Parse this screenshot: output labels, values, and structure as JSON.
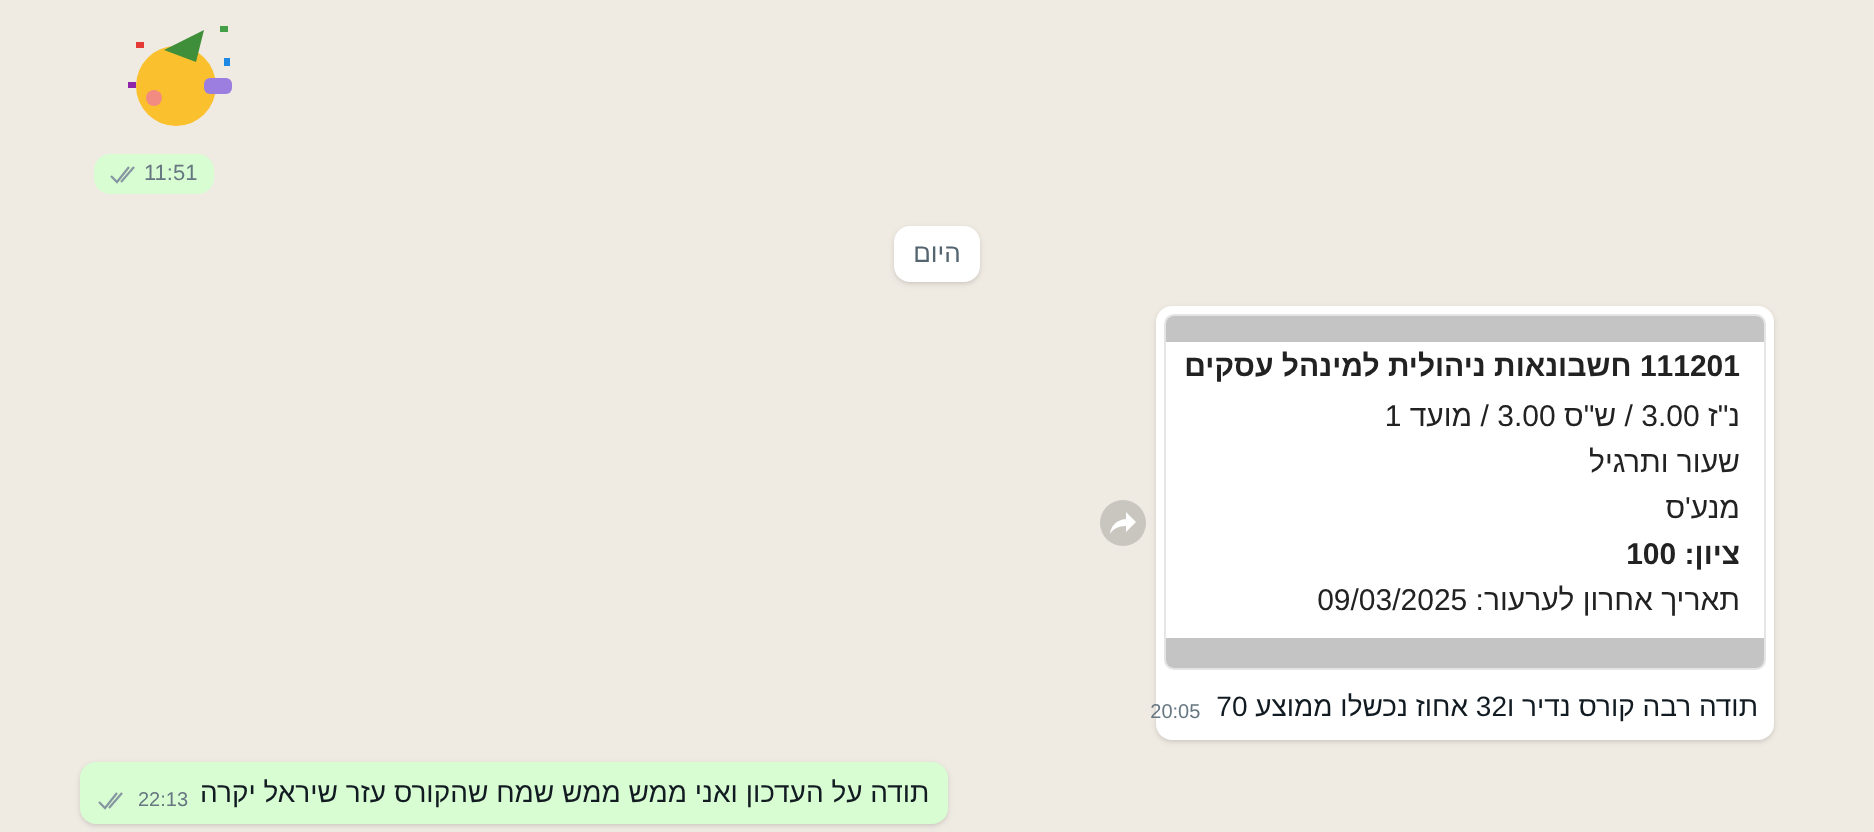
{
  "messages": [
    {
      "kind": "sticker",
      "time": "11:51"
    },
    {
      "kind": "date",
      "label": "היום"
    },
    {
      "kind": "card",
      "forwardable": true,
      "image_lines": [
        {
          "text": "111201 חשבונאות ניהולית למינהל עסקים",
          "bold": true
        },
        {
          "text": "נ\"ז 3.00 / ש\"ס 3.00 / מועד 1",
          "bold": false
        },
        {
          "text": "שעור ותרגיל",
          "bold": false
        },
        {
          "text": "מנע'ס",
          "bold": false
        },
        {
          "text": "ציון: 100",
          "bold": true
        },
        {
          "text": "תאריך אחרון לערעור: 09/03/2025",
          "bold": false
        }
      ],
      "caption": "תודה רבה קורס נדיר ו32 אחוז נכשלו ממוצע 70",
      "time": "20:05"
    },
    {
      "kind": "text",
      "text": "תודה על העדכון ואני ממש ממש שמח שהקורס עזר שיראל יקרה",
      "time": "22:13"
    }
  ]
}
